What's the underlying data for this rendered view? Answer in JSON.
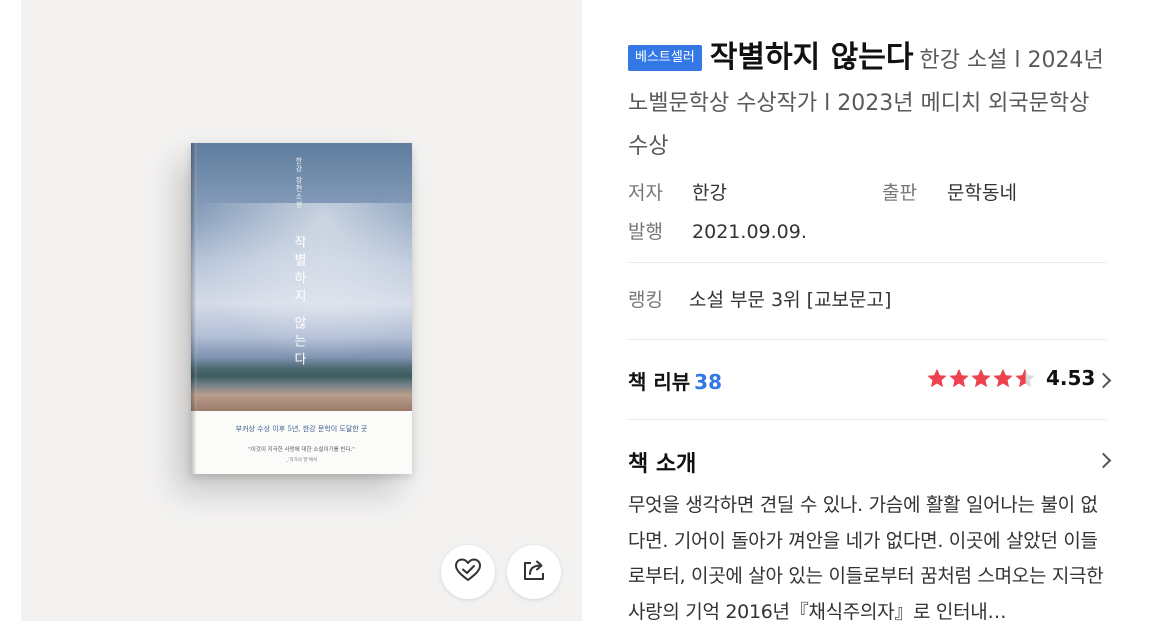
{
  "book": {
    "badge": "베스트셀러",
    "title": "작별하지 않는다",
    "subtitle": "한강 소설 l 2024년 노벨문학상 수상작가 l 2023년 메디치 외국문학상 수상",
    "cover": {
      "author": "한강 장편소설",
      "title": "작별하지 않는다",
      "tagline": "부커상 수상 이후 5년, 한강 문학이 도달한 곳",
      "quote": "\"이것이 지극한 사랑에 대한 소설이기를 빈다.\"",
      "quote_source": "_'작가의 말'에서"
    }
  },
  "meta": {
    "author_label": "저자",
    "author": "한강",
    "publisher_label": "출판",
    "publisher": "문학동네",
    "date_label": "발행",
    "date": "2021.09.09.",
    "ranking_label": "랭킹",
    "ranking": "소설 부문 3위 [교보문고]"
  },
  "review": {
    "label": "책 리뷰",
    "count": "38",
    "rating": "4.53",
    "rating_value": 4.53,
    "star_color": "#f0424e"
  },
  "intro": {
    "label": "책 소개",
    "text": "무엇을 생각하면 견딜 수 있나. 가슴에 활활 일어나는 불이 없다면. 기어이 돌아가 껴안을 네가 없다면. 이곳에 살았던 이들로부터, 이곳에 살아 있는 이들로부터 꿈처럼 스며오는 지극한 사랑의 기억 2016년『채식주의자』로 인터내…"
  },
  "actions": {
    "like_icon": "heart-check-icon",
    "share_icon": "share-icon"
  },
  "colors": {
    "accent": "#3478e5",
    "left_bg": "#f3f2f1"
  }
}
